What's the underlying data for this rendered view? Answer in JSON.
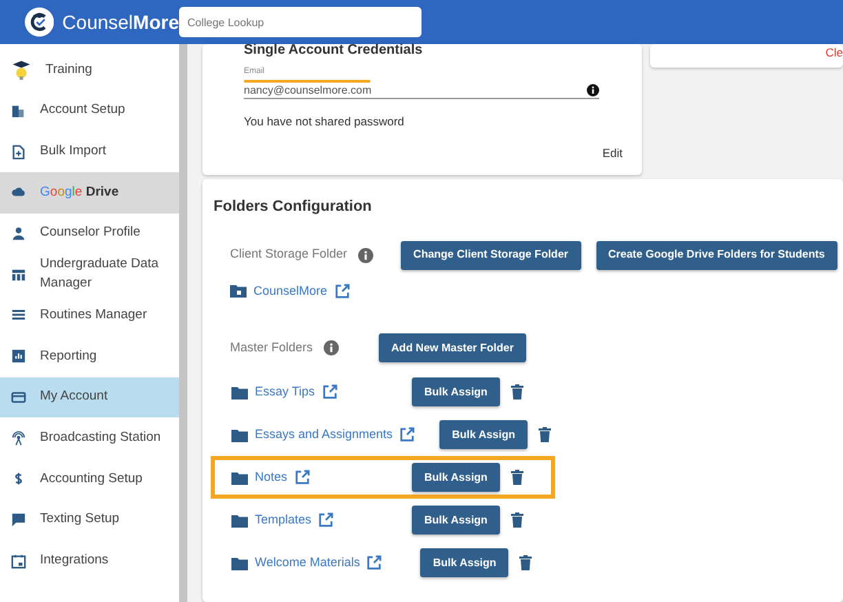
{
  "header": {
    "brand_light": "Counsel",
    "brand_bold": "More",
    "search": {
      "placeholder": "College Lookup"
    }
  },
  "sidebar": {
    "items": [
      {
        "label": "Training",
        "selected": false
      },
      {
        "label": "Account Setup",
        "selected": false
      },
      {
        "label": "Bulk Import",
        "selected": false
      },
      {
        "brand": "Google",
        "label": "Drive",
        "selected": false,
        "hover": true
      },
      {
        "label": "Counselor Profile",
        "selected": false
      },
      {
        "label": "Undergraduate Data Manager",
        "selected": false
      },
      {
        "label": "Routines Manager",
        "selected": false
      },
      {
        "label": "Reporting",
        "selected": false
      },
      {
        "label": "My Account",
        "selected": true
      },
      {
        "label": "Broadcasting Station",
        "selected": false
      },
      {
        "label": "Accounting Setup",
        "selected": false
      },
      {
        "label": "Texting Setup",
        "selected": false
      },
      {
        "label": "Integrations",
        "selected": false
      }
    ]
  },
  "credentials": {
    "title": "Single Account Credentials",
    "email_label": "Email",
    "email": "nancy@counselmore.com",
    "redacted": true,
    "note": "You have not shared password",
    "edit": "Edit"
  },
  "side_card": {
    "action": "Cle"
  },
  "folders": {
    "title": "Folders Configuration",
    "client_storage": {
      "label": "Client Storage Folder",
      "buttons": [
        "Change Client Storage Folder",
        "Create Google Drive Folders for Students"
      ],
      "folder": "CounselMore"
    },
    "master": {
      "label": "Master Folders",
      "button": "Add New Master Folder",
      "items": [
        {
          "name": "Essay Tips",
          "button": "Bulk Assign",
          "highlighted": false
        },
        {
          "name": "Essays and Assignments",
          "button": "Bulk Assign",
          "highlighted": false
        },
        {
          "name": "Notes",
          "button": "Bulk Assign",
          "highlighted": true
        },
        {
          "name": "Templates",
          "button": "Bulk Assign",
          "highlighted": false
        },
        {
          "name": "Welcome Materials",
          "button": "Bulk Assign",
          "highlighted": false
        }
      ]
    }
  }
}
